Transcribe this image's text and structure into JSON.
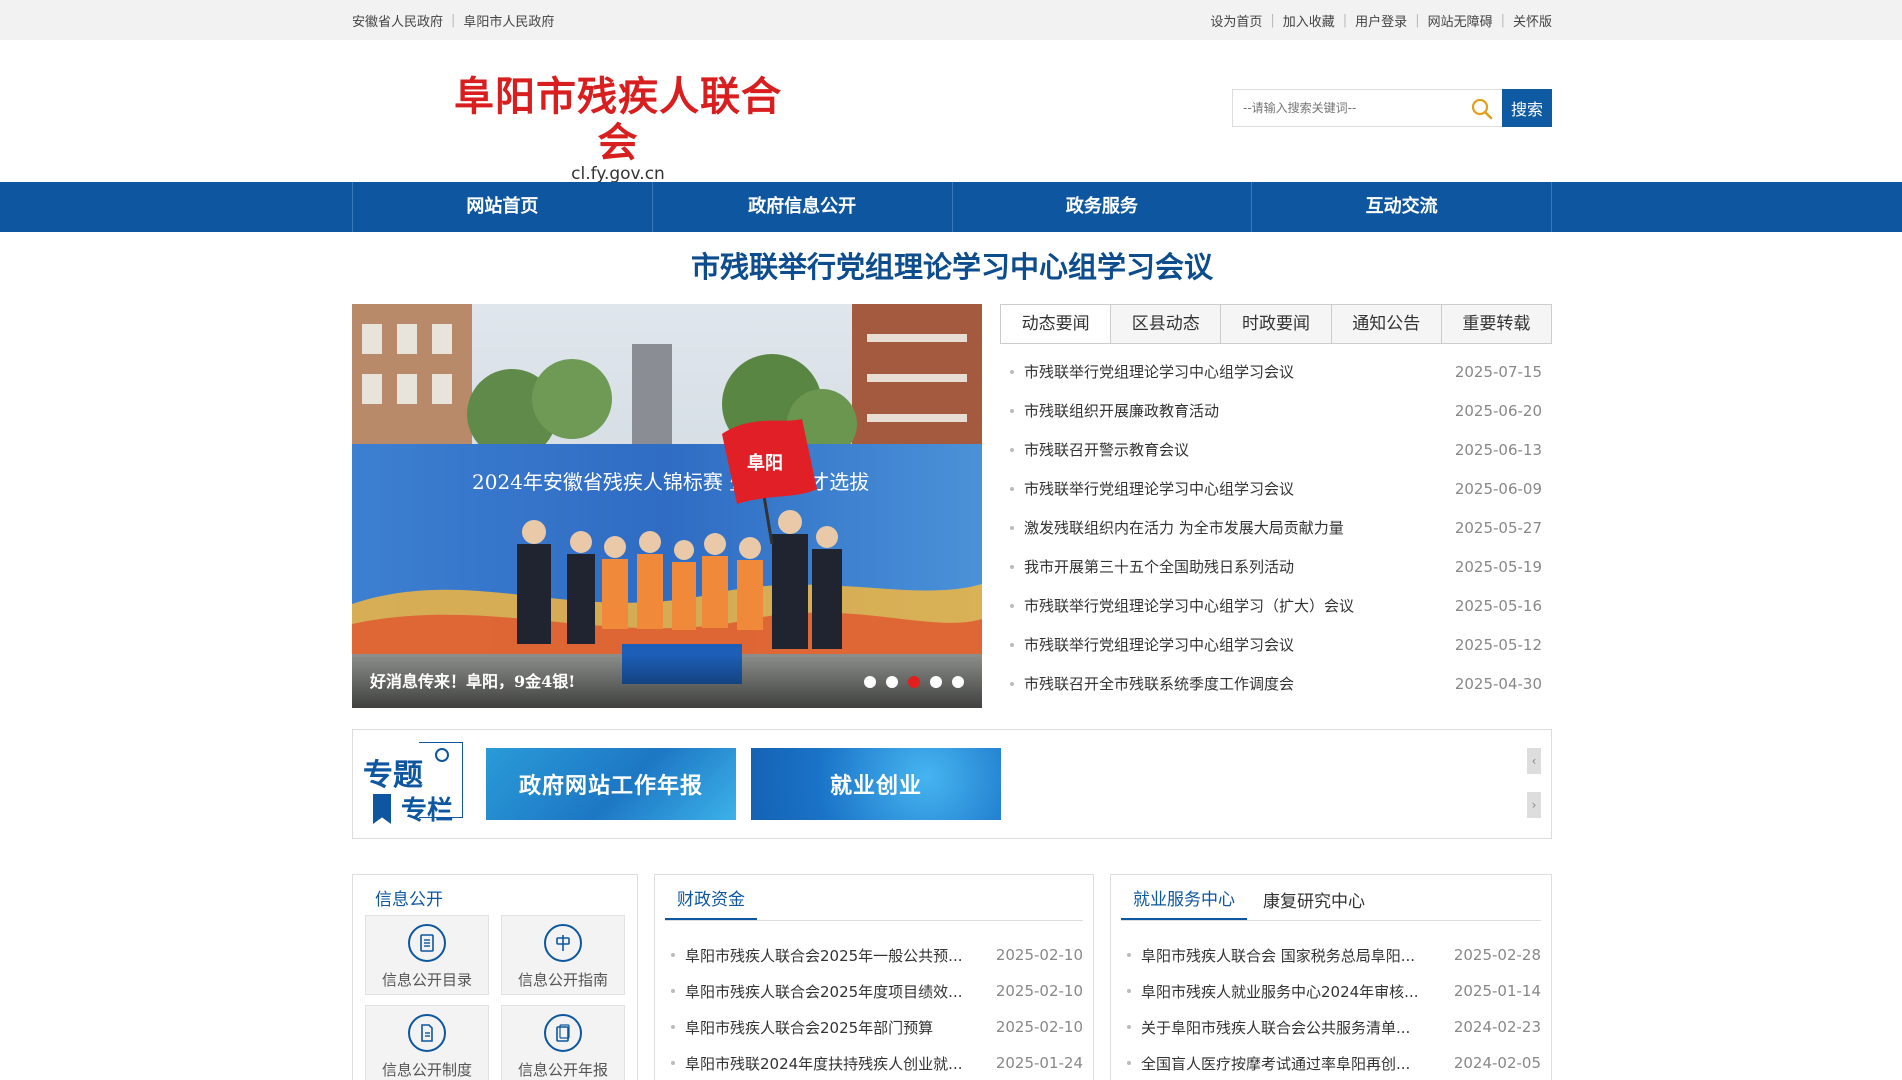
{
  "topbar": {
    "left_links": [
      "安徽省人民政府",
      "阜阳市人民政府"
    ],
    "right_links": [
      "设为首页",
      "加入收藏",
      "用户登录",
      "网站无障碍",
      "关怀版"
    ]
  },
  "header": {
    "logo_cn": "阜阳市残疾人联合会",
    "logo_en": "cl.fy.gov.cn",
    "search_placeholder": "--请输入搜索关键词--",
    "search_button": "搜索"
  },
  "nav": {
    "items": [
      "网站首页",
      "政府信息公开",
      "政务服务",
      "互动交流"
    ]
  },
  "headline": "市残联举行党组理论学习中心组学习会议",
  "slider": {
    "banner_text": "2024年安徽省残疾人锦标赛 暨后备人才选拔",
    "flag_text": "阜阳",
    "caption": "好消息传来！阜阳，9金4银!",
    "dots": 5,
    "active_dot": 3
  },
  "news": {
    "tabs": [
      "动态要闻",
      "区县动态",
      "时政要闻",
      "通知公告",
      "重要转载"
    ],
    "items": [
      {
        "title": "市残联举行党组理论学习中心组学习会议",
        "date": "2025-07-15"
      },
      {
        "title": "市残联组织开展廉政教育活动",
        "date": "2025-06-20"
      },
      {
        "title": "市残联召开警示教育会议",
        "date": "2025-06-13"
      },
      {
        "title": "市残联举行党组理论学习中心组学习会议",
        "date": "2025-06-09"
      },
      {
        "title": "激发残联组织内在活力 为全市发展大局贡献力量",
        "date": "2025-05-27"
      },
      {
        "title": "我市开展第三十五个全国助残日系列活动",
        "date": "2025-05-19"
      },
      {
        "title": "市残联举行党组理论学习中心组学习（扩大）会议",
        "date": "2025-05-16"
      },
      {
        "title": "市残联举行党组理论学习中心组学习会议",
        "date": "2025-05-12"
      },
      {
        "title": "市残联召开全市残联系统季度工作调度会",
        "date": "2025-04-30"
      }
    ]
  },
  "special": {
    "label_1": "专题",
    "label_2": "专栏",
    "banners": [
      "政府网站工作年报",
      "就业创业"
    ],
    "prev": "‹",
    "next": "›"
  },
  "info": {
    "title": "信息公开",
    "tiles": [
      "信息公开目录",
      "信息公开指南",
      "信息公开制度",
      "信息公开年报"
    ]
  },
  "finance": {
    "tab": "财政资金",
    "items": [
      {
        "title": "阜阳市残疾人联合会2025年一般公共预...",
        "date": "2025-02-10"
      },
      {
        "title": "阜阳市残疾人联合会2025年度项目绩效...",
        "date": "2025-02-10"
      },
      {
        "title": "阜阳市残疾人联合会2025年部门预算",
        "date": "2025-02-10"
      },
      {
        "title": "阜阳市残联2024年度扶持残疾人创业就...",
        "date": "2025-01-24"
      }
    ]
  },
  "employment": {
    "tabs": [
      "就业服务中心",
      "康复研究中心"
    ],
    "items": [
      {
        "title": "阜阳市残疾人联合会 国家税务总局阜阳...",
        "date": "2025-02-28"
      },
      {
        "title": "阜阳市残疾人就业服务中心2024年审核...",
        "date": "2025-01-14"
      },
      {
        "title": "关于阜阳市残疾人联合会公共服务清单...",
        "date": "2024-02-23"
      },
      {
        "title": "全国盲人医疗按摩考试通过率阜阳再创...",
        "date": "2024-02-05"
      }
    ]
  },
  "colors": {
    "brand_blue": "#0e57a0",
    "logo_red": "#d81e1e",
    "active_dot": "#e01f1f"
  }
}
